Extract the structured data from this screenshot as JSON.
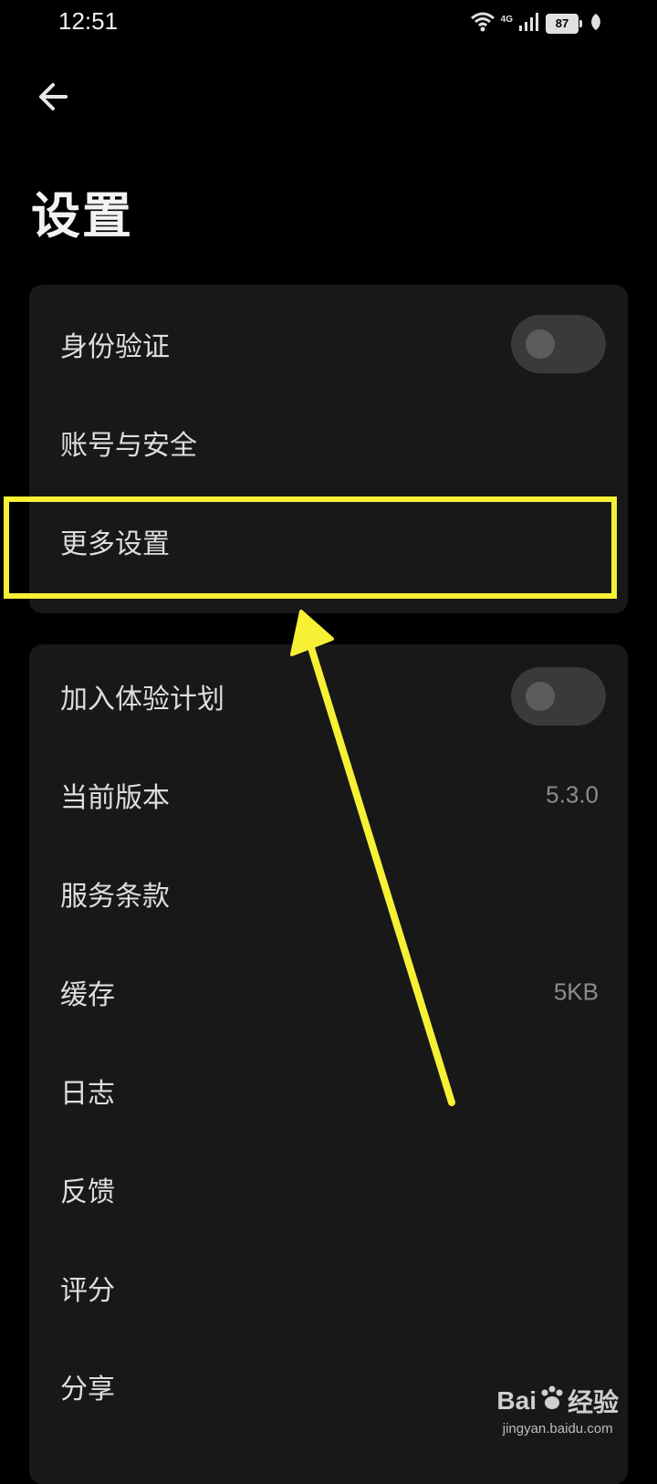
{
  "status_bar": {
    "time": "12:51",
    "network": "4G",
    "battery": "87"
  },
  "header": {
    "title": "设置"
  },
  "card1": {
    "items": [
      {
        "label": "身份验证",
        "toggle": false
      },
      {
        "label": "账号与安全"
      },
      {
        "label": "更多设置"
      }
    ]
  },
  "card2": {
    "items": [
      {
        "label": "加入体验计划",
        "toggle": false
      },
      {
        "label": "当前版本",
        "value": "5.3.0"
      },
      {
        "label": "服务条款"
      },
      {
        "label": "缓存",
        "value": "5KB"
      },
      {
        "label": "日志"
      },
      {
        "label": "反馈"
      },
      {
        "label": "评分"
      },
      {
        "label": "分享"
      }
    ]
  },
  "watermark": {
    "brand_a": "Bai",
    "brand_b": "经验",
    "url": "jingyan.baidu.com"
  },
  "colors": {
    "background": "#000000",
    "card": "#181818",
    "highlight": "#f7f034",
    "toggle_track": "#3a3a3a"
  }
}
